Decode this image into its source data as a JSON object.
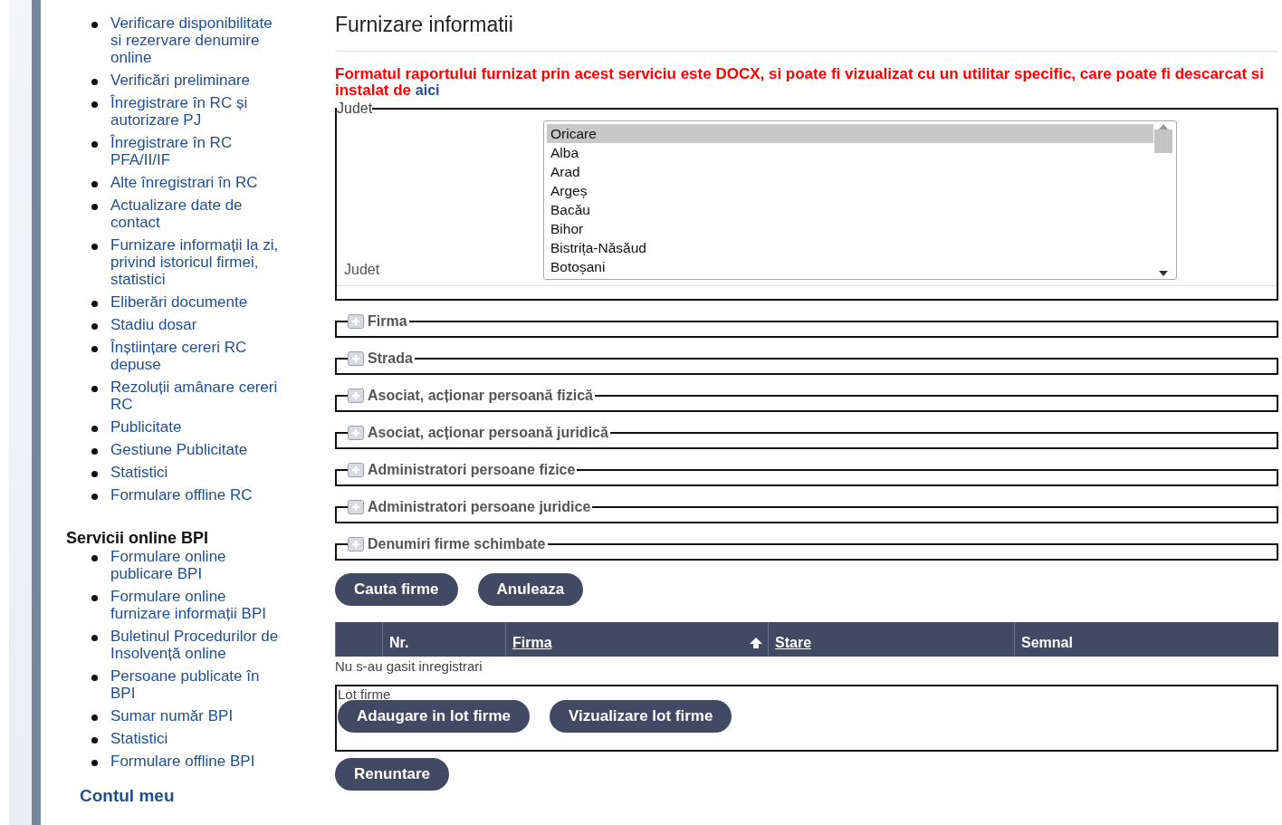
{
  "sidebar": {
    "items": [
      {
        "label": "Verificare disponibilitate si rezervare denumire online"
      },
      {
        "label": "Verificări preliminare"
      },
      {
        "label": "Înregistrare în RC și autorizare PJ"
      },
      {
        "label": "Înregistrare în RC PFA/II/IF"
      },
      {
        "label": "Alte înregistrari în RC"
      },
      {
        "label": "Actualizare date de contact"
      },
      {
        "label": "Furnizare informații la zi, privind istoricul firmei, statistici"
      },
      {
        "label": "Eliberări documente"
      },
      {
        "label": "Stadiu dosar"
      },
      {
        "label": "Înștiințare cereri RC depuse"
      },
      {
        "label": "Rezoluții amânare cereri RC"
      },
      {
        "label": "Publicitate"
      },
      {
        "label": "Gestiune Publicitate"
      },
      {
        "label": "Statistici"
      },
      {
        "label": "Formulare offline RC"
      }
    ],
    "bpi_heading": "Servicii online BPI",
    "bpi_items": [
      {
        "label": "Formulare online publicare BPI"
      },
      {
        "label": "Formulare online furnizare informații BPI"
      },
      {
        "label": "Buletinul Procedurilor de Insolvență online"
      },
      {
        "label": "Persoane publicate în BPI"
      },
      {
        "label": "Sumar număr BPI"
      },
      {
        "label": "Statistici"
      },
      {
        "label": "Formulare offline BPI"
      }
    ],
    "account_link": "Contul meu"
  },
  "main": {
    "title": "Furnizare informatii",
    "notice": {
      "text": "Formatul raportului furnizat prin acest serviciu este DOCX, si poate fi vizualizat cu un utilitar specific, care poate fi descarcat si instalat de ",
      "link": "aici"
    },
    "county": {
      "legend": "Judet",
      "label": "Judet",
      "options": [
        {
          "label": "Oricare",
          "selected": true
        },
        {
          "label": "Alba",
          "selected": false
        },
        {
          "label": "Arad",
          "selected": false
        },
        {
          "label": "Argeș",
          "selected": false
        },
        {
          "label": "Bacău",
          "selected": false
        },
        {
          "label": "Bihor",
          "selected": false
        },
        {
          "label": "Bistrița-Năsăud",
          "selected": false
        },
        {
          "label": "Botoșani",
          "selected": false
        }
      ]
    },
    "sections": [
      {
        "label": "Firma",
        "expanded": false
      },
      {
        "label": "Strada",
        "expanded": false
      },
      {
        "label": "Asociat, acționar persoană fizică",
        "expanded": false
      },
      {
        "label": "Asociat, acționar persoană juridică",
        "expanded": false
      },
      {
        "label": "Administratori persoane fizice",
        "expanded": false
      },
      {
        "label": "Administratori persoane juridice",
        "expanded": false
      },
      {
        "label": "Denumiri firme schimbate",
        "expanded": false
      }
    ],
    "buttons": [
      "Cauta firme",
      "Anuleaza"
    ],
    "table": {
      "columns": [
        {
          "label": "Nr.",
          "sortable": false,
          "sorted": false
        },
        {
          "label": "Firma",
          "sortable": true,
          "sorted": true
        },
        {
          "label": "Stare",
          "sortable": true,
          "sorted": false
        },
        {
          "label": "Semnal",
          "sortable": false,
          "sorted": false
        }
      ],
      "empty_message": "Nu s-au gasit inregistrari"
    },
    "batch": {
      "legend": "Lot firme",
      "buttons": [
        "Adaugare in lot firme",
        "Vizualizare lot firme"
      ]
    },
    "cancel_button": "Renuntare"
  }
}
